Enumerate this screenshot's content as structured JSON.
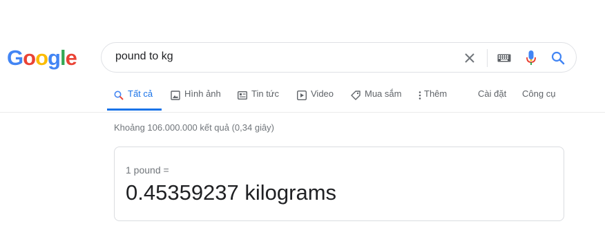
{
  "logo": {
    "letters": [
      "G",
      "o",
      "o",
      "g",
      "l",
      "e"
    ],
    "colors": [
      "#4285F4",
      "#EA4335",
      "#FBBC05",
      "#4285F4",
      "#34A853",
      "#EA4335"
    ]
  },
  "search": {
    "query": "pound to kg"
  },
  "icons": {
    "clear": "close-icon",
    "keyboard": "keyboard-icon",
    "mic": "microphone-icon",
    "search": "search-icon"
  },
  "tabs": [
    {
      "label": "Tất cả",
      "icon": "search-icon",
      "active": true
    },
    {
      "label": "Hình ảnh",
      "icon": "image-icon"
    },
    {
      "label": "Tin tức",
      "icon": "news-icon"
    },
    {
      "label": "Video",
      "icon": "video-icon"
    },
    {
      "label": "Mua sắm",
      "icon": "tag-icon"
    },
    {
      "label": "Thêm",
      "icon": "more-vert-icon"
    }
  ],
  "tools": {
    "settings": "Cài đặt",
    "tools": "Công cụ"
  },
  "stats": "Khoảng 106.000.000 kết quả (0,34 giây)",
  "converter": {
    "from": "1 pound =",
    "result": "0.45359237 kilograms"
  },
  "accent": "#1a73e8"
}
